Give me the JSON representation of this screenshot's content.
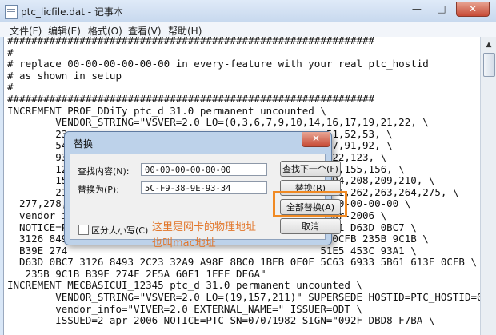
{
  "window": {
    "title": "ptc_licfile.dat - 记事本",
    "minimize_glyph": "—",
    "maximize_glyph": "□",
    "close_glyph": "✕"
  },
  "menu": [
    "文件(F)",
    "编辑(E)",
    "格式(O)",
    "查看(V)",
    "帮助(H)"
  ],
  "editor": {
    "lines": [
      "#############################################################",
      "#",
      "# replace 00-00-00-00-00-00 in every-feature with your real ptc_hostid",
      "# as shown in setup",
      "#",
      "#############################################################",
      "INCREMENT PROE_DDiTy ptc_d 31.0 permanent uncounted \\",
      "        VENDOR_STRING=\"VSVER=2.0 LO=(0,3,6,7,9,10,14,16,17,19,21,22, \\",
      "        23                                           51,52,53, \\",
      "        54                                           77,91,92, \\",
      "        93                                           122,123, \\",
      "        12                                           48,155,156, \\",
      "        15                                           194,208,209,210, \\",
      "        21                                           261,262,263,264,275, \\",
      "  277,278,                                         00-00-00-00-00 \\",
      "  vendor_i                                         2-apr-2006 \\",
      "  NOTICE=P                                          93A1 D63D 0BC7 \\",
      "  3126 849                                          F 0CFB 235B 9C1B \\",
      "  B39E 274                                          51E5 453C 93A1 \\",
      "  D63D 0BC7 3126 8493 2C23 32A9 A98F 8BC0 1BEB 0F0F 5C63 6933 5B61 613F 0CFB \\",
      "   235B 9C1B B39E 274F 2E5A 60E1 1FEF DE6A\"",
      "INCREMENT MECBASICUI_12345 ptc_d 31.0 permanent uncounted \\",
      "        VENDOR_STRING=\"VSVER=2.0 LO=(19,157,211)\" SUPERSEDE HOSTID=PTC_HOSTID=0",
      "        vendor_info=\"VIVER=2.0 EXTERNAL_NAME=\" ISSUER=ODT \\",
      "        ISSUED=2-apr-2006 NOTICE=PTC SN=07071982 SIGN=\"092F DBD8 F7BA \\"
    ]
  },
  "dialog": {
    "title": "替换",
    "close_glyph": "✕",
    "find_label": "查找内容(N):",
    "find_value": "00-00-00-00-00-00",
    "replace_label": "替换为(P):",
    "replace_value": "5C-F9-38-9E-93-34",
    "match_case_label": "区分大小写(C)",
    "match_case_checked": false,
    "buttons": {
      "find_next": "查找下一个(F)",
      "replace": "替换(R)",
      "replace_all": "全部替换(A)",
      "cancel": "取消"
    }
  },
  "annotation": {
    "text": "这里是网卡的物理地址也叫mac地址",
    "color": "#f08a24"
  },
  "colors": {
    "highlight": "#f08a24",
    "close_button": "#c74a35"
  }
}
